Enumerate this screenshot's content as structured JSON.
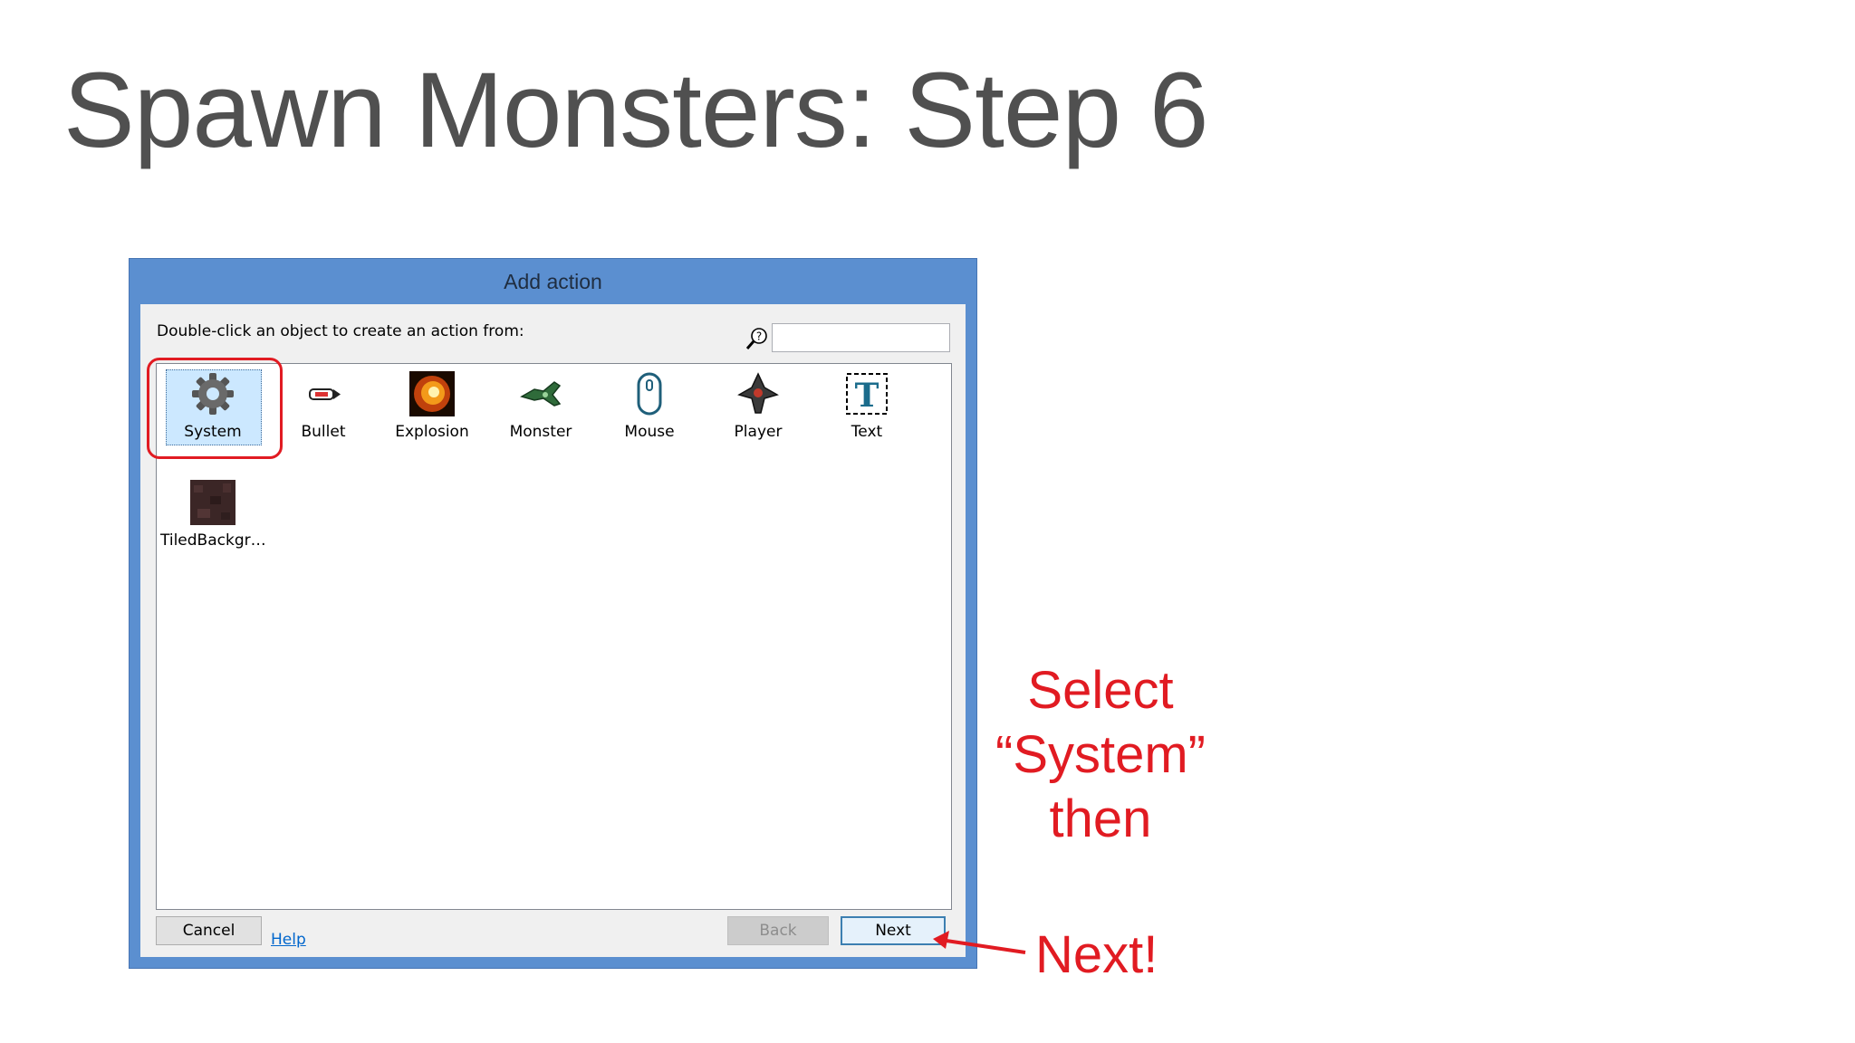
{
  "slide": {
    "title": "Spawn Monsters: Step 6"
  },
  "dialog": {
    "title": "Add action",
    "prompt": "Double-click an object to create an action from:",
    "search": {
      "value": "",
      "placeholder": ""
    },
    "objects": [
      {
        "label": "System",
        "icon": "gear-icon",
        "selected": true
      },
      {
        "label": "Bullet",
        "icon": "bullet-icon",
        "selected": false
      },
      {
        "label": "Explosion",
        "icon": "explosion-icon",
        "selected": false
      },
      {
        "label": "Monster",
        "icon": "monster-icon",
        "selected": false
      },
      {
        "label": "Mouse",
        "icon": "mouse-icon",
        "selected": false
      },
      {
        "label": "Player",
        "icon": "player-ship-icon",
        "selected": false
      },
      {
        "label": "Text",
        "icon": "text-object-icon",
        "selected": false
      },
      {
        "label": "TiledBackgr…",
        "icon": "tiled-background-icon",
        "selected": false
      }
    ],
    "buttons": {
      "cancel": "Cancel",
      "help": "Help",
      "back": "Back",
      "next": "Next"
    }
  },
  "annotations": {
    "instruction": [
      "Select",
      "“System”",
      "then"
    ],
    "next_callout": "Next!"
  },
  "colors": {
    "dialog_frame": "#5b8fd0",
    "annotation_red": "#e11b22",
    "selection_fill": "#cce8ff",
    "link_blue": "#0066cc"
  }
}
